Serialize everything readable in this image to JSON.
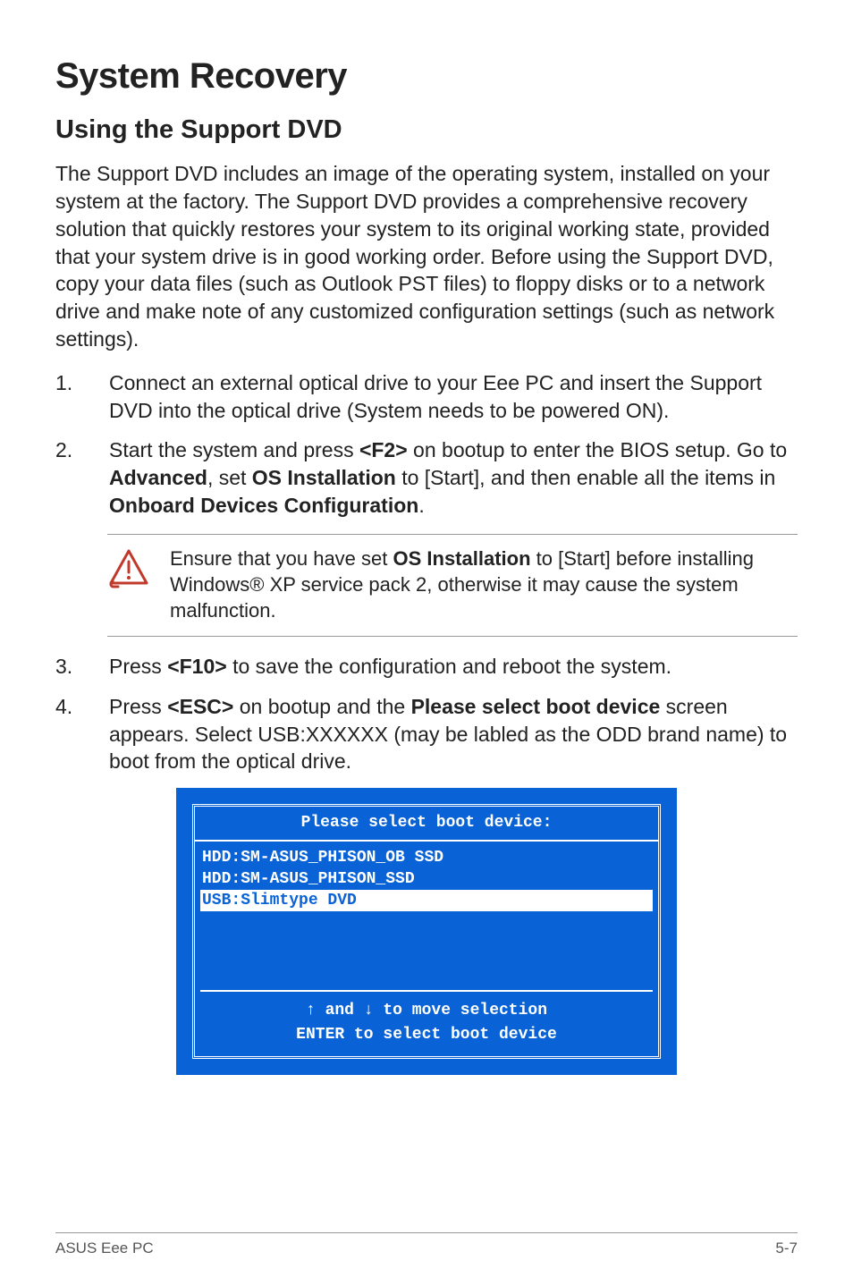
{
  "title": "System Recovery",
  "subtitle": "Using the Support DVD",
  "intro": "The Support DVD includes an image of the operating system, installed on your system at the factory. The Support DVD provides a comprehensive recovery solution that quickly restores your system to its original working state, provided that your system drive is in good working order. Before using the Support DVD, copy your data files (such as Outlook PST files) to floppy disks or to a network drive and make note of any customized configuration settings (such as network settings).",
  "steps": {
    "s1": "Connect an external optical drive to your Eee PC and insert the Support DVD into the optical drive (System needs to be powered ON).",
    "s2_pre": "Start the system and press ",
    "s2_key1": "<F2>",
    "s2_mid1": " on bootup to enter the BIOS setup. Go to ",
    "s2_adv": "Advanced",
    "s2_mid2": ", set ",
    "s2_osi": "OS Installation",
    "s2_mid3": " to [Start], and then enable all the items in ",
    "s2_odc": "Onboard Devices Configuration",
    "s2_end": ".",
    "s3_pre": "Press ",
    "s3_key": "<F10>",
    "s3_post": " to save the configuration and reboot the system.",
    "s4_pre": "Press ",
    "s4_key": "<ESC>",
    "s4_mid1": " on bootup and the ",
    "s4_bold": "Please select boot device",
    "s4_post": " screen appears. Select USB:XXXXXX (may be labled as the ODD brand name) to boot from the optical drive."
  },
  "warning": {
    "pre": "Ensure that you have set ",
    "bold": "OS Installation",
    "post": " to [Start] before installing Windows® XP service pack 2, otherwise it may cause the system malfunction."
  },
  "boot": {
    "title": "Please select boot device:",
    "line1": "HDD:SM-ASUS_PHISON_OB SSD",
    "line2": "HDD:SM-ASUS_PHISON_SSD",
    "line3": "USB:Slimtype DVD",
    "footer1": "↑ and ↓ to move selection",
    "footer2": "ENTER to select boot device"
  },
  "footer": {
    "left": "ASUS Eee PC",
    "right": "5-7"
  }
}
